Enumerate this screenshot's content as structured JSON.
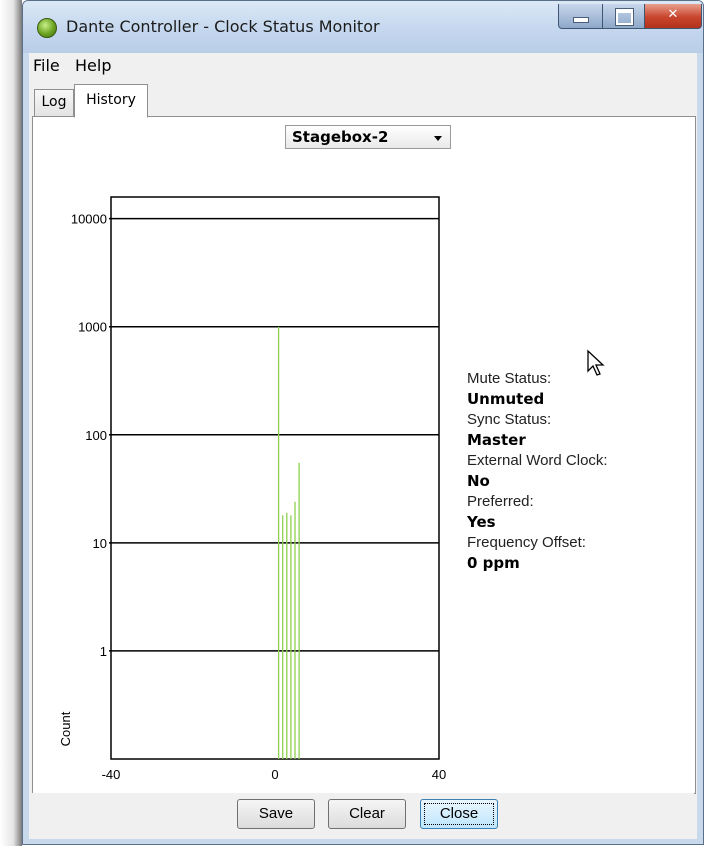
{
  "window": {
    "title": "Dante Controller - Clock Status Monitor",
    "controls": {
      "minimize": "minimize",
      "maximize": "maximize",
      "close": "✕"
    }
  },
  "menu": {
    "items": [
      "File",
      "Help"
    ]
  },
  "tabs": {
    "log": "Log",
    "history": "History",
    "active": "History"
  },
  "device_select": {
    "value": "Stagebox-2"
  },
  "chart_data": {
    "type": "bar",
    "ylabel": "Count",
    "yscale": "log",
    "y_ticks": [
      "10000",
      "1000",
      "100",
      "10",
      "1"
    ],
    "x_ticks": [
      "-40",
      "0",
      "40"
    ],
    "xlim": [
      -40,
      40
    ],
    "ylim_decades": [
      0.1,
      20000
    ],
    "bar_color": "#8fd14f",
    "series": [
      {
        "values": [
          {
            "x": 1,
            "y": 1000
          },
          {
            "x": 2,
            "y": 18
          },
          {
            "x": 3,
            "y": 19
          },
          {
            "x": 4,
            "y": 18
          },
          {
            "x": 5,
            "y": 24
          },
          {
            "x": 6,
            "y": 55
          }
        ]
      }
    ]
  },
  "status": {
    "mute_label": "Mute Status:",
    "mute_value": "Unmuted",
    "sync_label": "Sync Status:",
    "sync_value": "Master",
    "wordclock_label": "External Word Clock:",
    "wordclock_value": "No",
    "preferred_label": "Preferred:",
    "preferred_value": "Yes",
    "offset_label": "Frequency Offset:",
    "offset_value": "0 ppm"
  },
  "footer": {
    "save": "Save",
    "clear": "Clear",
    "close": "Close"
  }
}
